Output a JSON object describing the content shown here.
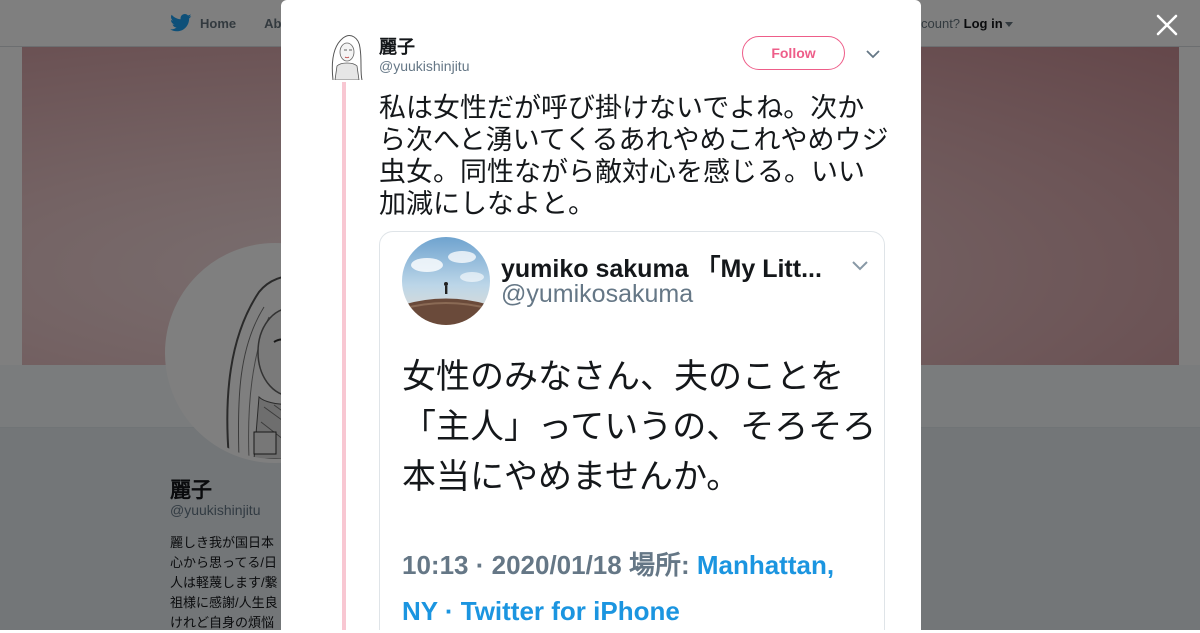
{
  "nav": {
    "home_label": "Home",
    "about_label": "Abo",
    "account_prompt": "count?",
    "login_label": "Log in"
  },
  "profile": {
    "name": "麗子",
    "handle": "@yuukishinjitu",
    "bio_lines": [
      "麗しき我が国日本",
      "心から思ってる/日",
      "人は軽蔑します/繋",
      "祖様に感謝/人生良",
      "けれど自身の煩悩"
    ]
  },
  "tweet": {
    "author_name": "麗子",
    "author_handle": "@yuukishinjitu",
    "follow_label": "Follow",
    "text": "私は女性だが呼び掛けないでよね。次から次へと湧いてくるあれやめこれやめウジ虫女。同性ながら敵対心を感じる。いい加減にしなよと。"
  },
  "quoted": {
    "name": "yumiko sakuma 「My Litt...",
    "handle": "@yumikosakuma",
    "text_lines": [
      "女性のみなさん、夫のことを",
      "「主人」っていうの、そろそろ",
      "本当にやめませんか。"
    ],
    "meta_time": "10:13 · 2020/01/18 場所: ",
    "meta_place": "Manhattan,",
    "meta_line2": "NY · Twitter for iPhone"
  },
  "colors": {
    "follow_accent": "#ee5d89",
    "thread_line": "#f8c7d2",
    "link_blue": "#1b95e0",
    "twitter_blue": "#1da1f2"
  },
  "icons": [
    "twitter-bird-icon",
    "close-icon",
    "chevron-down-icon",
    "caret-down-icon"
  ]
}
